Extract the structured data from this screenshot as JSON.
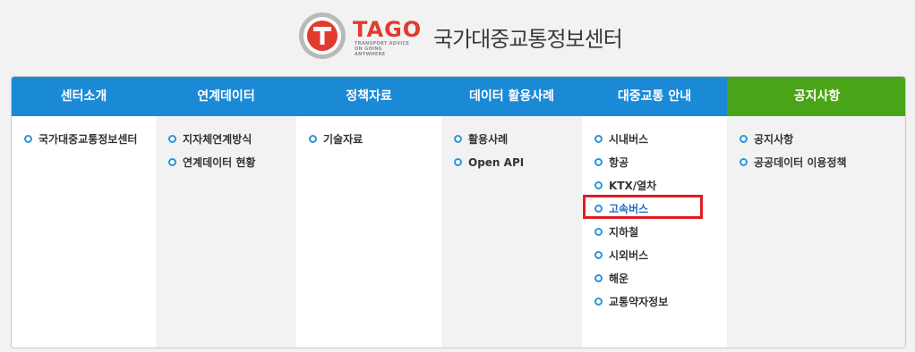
{
  "header": {
    "logo_text": "TAGO",
    "logo_tagline": "TRANSPORT ADVICE ON GOING ANYWHERE",
    "site_title": "국가대중교통정보센터"
  },
  "nav": {
    "tabs": [
      {
        "label": "센터소개"
      },
      {
        "label": "연계데이터"
      },
      {
        "label": "정책자료"
      },
      {
        "label": "데이터 활용사례"
      },
      {
        "label": "대중교통 안내"
      },
      {
        "label": "공지사항",
        "active": true
      }
    ],
    "columns": [
      {
        "items": [
          "국가대중교통정보센터"
        ]
      },
      {
        "items": [
          "지자체연계방식",
          "연계데이터 현황"
        ]
      },
      {
        "items": [
          "기술자료"
        ]
      },
      {
        "items": [
          "활용사례",
          "Open API"
        ]
      },
      {
        "items": [
          "시내버스",
          "항공",
          "KTX/열차",
          "고속버스",
          "지하철",
          "시외버스",
          "해운",
          "교통약자정보"
        ],
        "highlighted": "고속버스"
      },
      {
        "items": [
          "공지사항",
          "공공데이터 이용정책"
        ]
      }
    ]
  },
  "colors": {
    "tab_blue": "#1b8ad6",
    "tab_green": "#4aa418",
    "highlight_red": "#e21b23",
    "logo_red": "#e23a2e"
  }
}
